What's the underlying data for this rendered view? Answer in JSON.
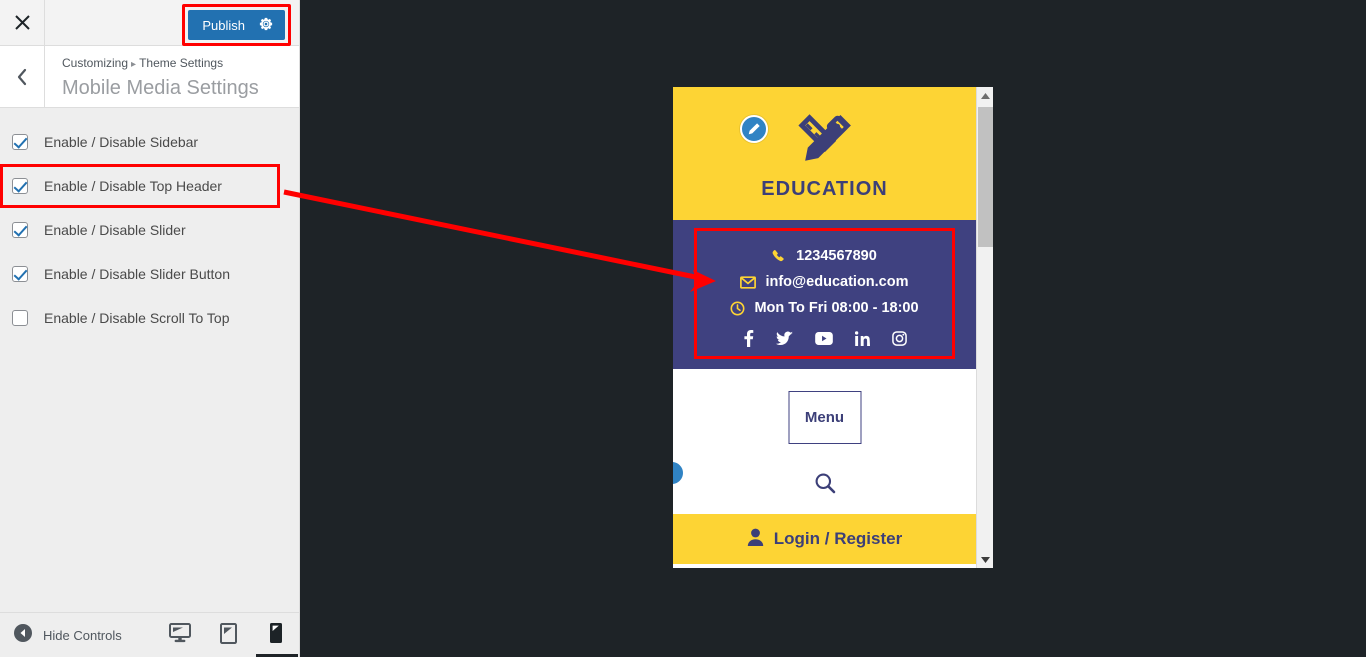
{
  "panel": {
    "close_label": "×",
    "close_icon": "close-icon",
    "publish_label": "Publish",
    "gear_icon": "gear-icon",
    "back_icon": "chevron-left-icon",
    "breadcrumb": {
      "root": "Customizing",
      "separator": "▸",
      "current": "Theme Settings"
    },
    "section_title": "Mobile Media Settings",
    "controls": [
      {
        "label": "Enable / Disable Sidebar",
        "checked": true,
        "highlighted": false
      },
      {
        "label": "Enable / Disable Top Header",
        "checked": true,
        "highlighted": true
      },
      {
        "label": "Enable / Disable Slider",
        "checked": true,
        "highlighted": false
      },
      {
        "label": "Enable / Disable Slider Button",
        "checked": true,
        "highlighted": false
      },
      {
        "label": "Enable / Disable Scroll To Top",
        "checked": false,
        "highlighted": false
      }
    ],
    "footer": {
      "hide_controls_label": "Hide Controls",
      "collapse_icon": "collapse-arrow-icon",
      "devices": [
        {
          "name": "desktop",
          "icon": "desktop-icon",
          "active": false
        },
        {
          "name": "tablet",
          "icon": "tablet-icon",
          "active": false
        },
        {
          "name": "mobile",
          "icon": "mobile-icon",
          "active": true
        }
      ]
    }
  },
  "preview": {
    "site": {
      "logo_icon": "pencil-ruler-logo-icon",
      "site_name": "EDUCATION",
      "edit_pin_icon": "edit-pencil-icon",
      "top_header": {
        "phone": {
          "icon": "phone-icon",
          "text": "1234567890"
        },
        "email": {
          "icon": "envelope-icon",
          "text": "info@education.com"
        },
        "hours": {
          "icon": "clock-icon",
          "text": "Mon To Fri 08:00 - 18:00"
        },
        "socials": [
          {
            "name": "facebook-icon",
            "glyph": "f"
          },
          {
            "name": "twitter-icon",
            "glyph": "t"
          },
          {
            "name": "youtube-icon",
            "glyph": "y"
          },
          {
            "name": "linkedin-icon",
            "glyph": "in"
          },
          {
            "name": "instagram-icon",
            "glyph": "i"
          }
        ]
      },
      "menu_label": "Menu",
      "search_icon": "search-icon",
      "login_label": "Login / Register",
      "login_icon": "user-icon"
    },
    "scrollbar": {
      "up_icon": "scroll-up-arrow-icon",
      "down_icon": "scroll-down-arrow-icon"
    }
  },
  "colors": {
    "publish_blue": "#2271b1",
    "annotation_red": "#ff0000",
    "theme_yellow": "#fdd434",
    "theme_purple": "#3f4180",
    "preview_bg": "#1e2327"
  }
}
